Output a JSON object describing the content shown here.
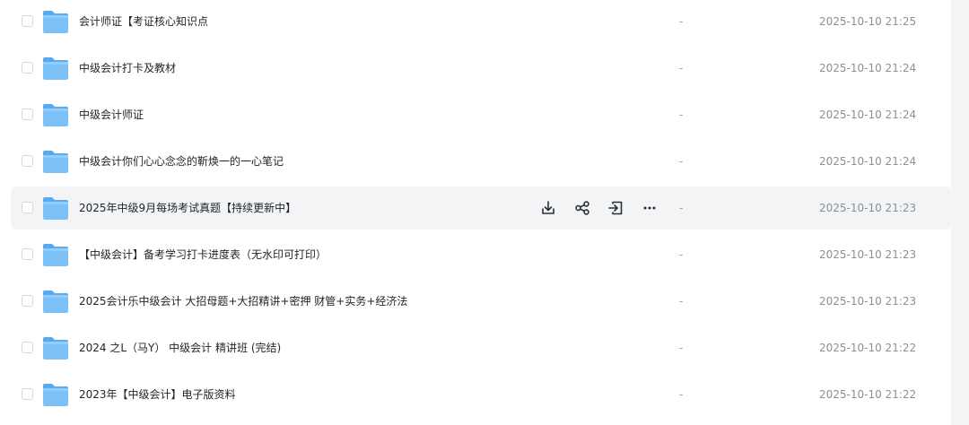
{
  "rows": [
    {
      "name": "会计师证【考证核心知识点",
      "size": "-",
      "date": "2025-10-10 21:25"
    },
    {
      "name": "中级会计打卡及教材",
      "size": "-",
      "date": "2025-10-10 21:24"
    },
    {
      "name": "中级会计师证",
      "size": "-",
      "date": "2025-10-10 21:24"
    },
    {
      "name": "中级会计你们心心念念的靳焕一的一心笔记",
      "size": "-",
      "date": "2025-10-10 21:24"
    },
    {
      "name": "2025年中级9月每场考试真题【持续更新中】",
      "size": "-",
      "date": "2025-10-10 21:23"
    },
    {
      "name": "【中级会计】备考学习打卡进度表（无水印可打印）",
      "size": "-",
      "date": "2025-10-10 21:23"
    },
    {
      "name": "2025会计乐中级会计 大招母题+大招精讲+密押 财管+实务+经济法",
      "size": "-",
      "date": "2025-10-10 21:23"
    },
    {
      "name": "2024 之L（马Y） 中级会计 精讲班 (完结)",
      "size": "-",
      "date": "2025-10-10 21:22"
    },
    {
      "name": "2023年【中级会计】电子版资料",
      "size": "-",
      "date": "2025-10-10 21:22"
    }
  ],
  "hover_row_index": 4,
  "row_actions": [
    "download-icon",
    "share-icon",
    "move-icon",
    "more-icon"
  ],
  "colors": {
    "folder": "#6cb6f4",
    "hover_bg": "#f3f4f6",
    "text": "#1f2329",
    "muted": "#8a9099"
  }
}
